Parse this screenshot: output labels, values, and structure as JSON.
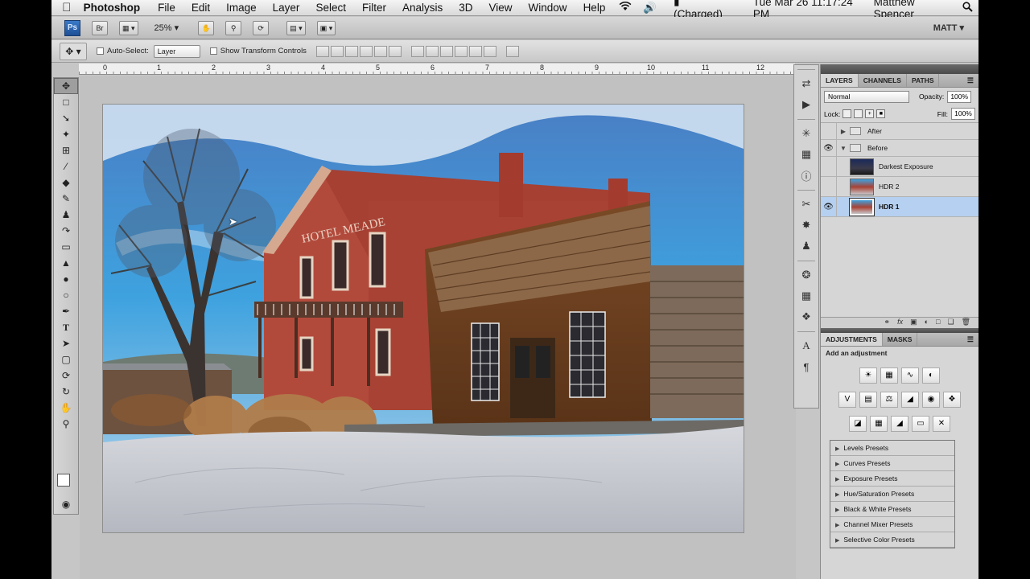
{
  "menubar": {
    "apple": "",
    "app": "Photoshop",
    "menus": [
      "File",
      "Edit",
      "Image",
      "Layer",
      "Select",
      "Filter",
      "Analysis",
      "3D",
      "View",
      "Window",
      "Help"
    ],
    "battery": "(Charged)",
    "clock": "Tue Mar 26  11:17:24 PM",
    "user": "Matthew Spencer"
  },
  "appbar": {
    "ps": "Ps",
    "br": "Br",
    "zoom": "25%",
    "workspace": "MATT ▾"
  },
  "options": {
    "auto_select": "Auto-Select:",
    "auto_select_value": "Layer",
    "transform": "Show Transform Controls"
  },
  "ruler": {
    "marks": [
      "0",
      "1",
      "2",
      "3",
      "4",
      "5",
      "6",
      "7",
      "8",
      "9",
      "10",
      "11",
      "12"
    ]
  },
  "layers_panel": {
    "tabs": [
      "LAYERS",
      "CHANNELS",
      "PATHS"
    ],
    "blend_mode": "Normal",
    "opacity_label": "Opacity:",
    "opacity": "100%",
    "lock_label": "Lock:",
    "fill_label": "Fill:",
    "fill": "100%",
    "layers": [
      {
        "name": "After",
        "kind": "group",
        "visible": false,
        "expanded": false
      },
      {
        "name": "Before",
        "kind": "group",
        "visible": true,
        "expanded": true
      },
      {
        "name": "Darkest Exposure",
        "kind": "layer",
        "visible": false
      },
      {
        "name": "HDR 2",
        "kind": "layer",
        "visible": false
      },
      {
        "name": "HDR 1",
        "kind": "layer",
        "visible": true,
        "selected": true
      }
    ]
  },
  "adjustments_panel": {
    "tabs": [
      "ADJUSTMENTS",
      "MASKS"
    ],
    "title": "Add an adjustment",
    "presets": [
      "Levels Presets",
      "Curves Presets",
      "Exposure Presets",
      "Hue/Saturation Presets",
      "Black & White Presets",
      "Channel Mixer Presets",
      "Selective Color Presets"
    ]
  },
  "photo": {
    "sign": "HOTEL MEADE"
  },
  "colors": {
    "selection": "#b5d0f0",
    "ps_blue": "#2a62ad"
  }
}
